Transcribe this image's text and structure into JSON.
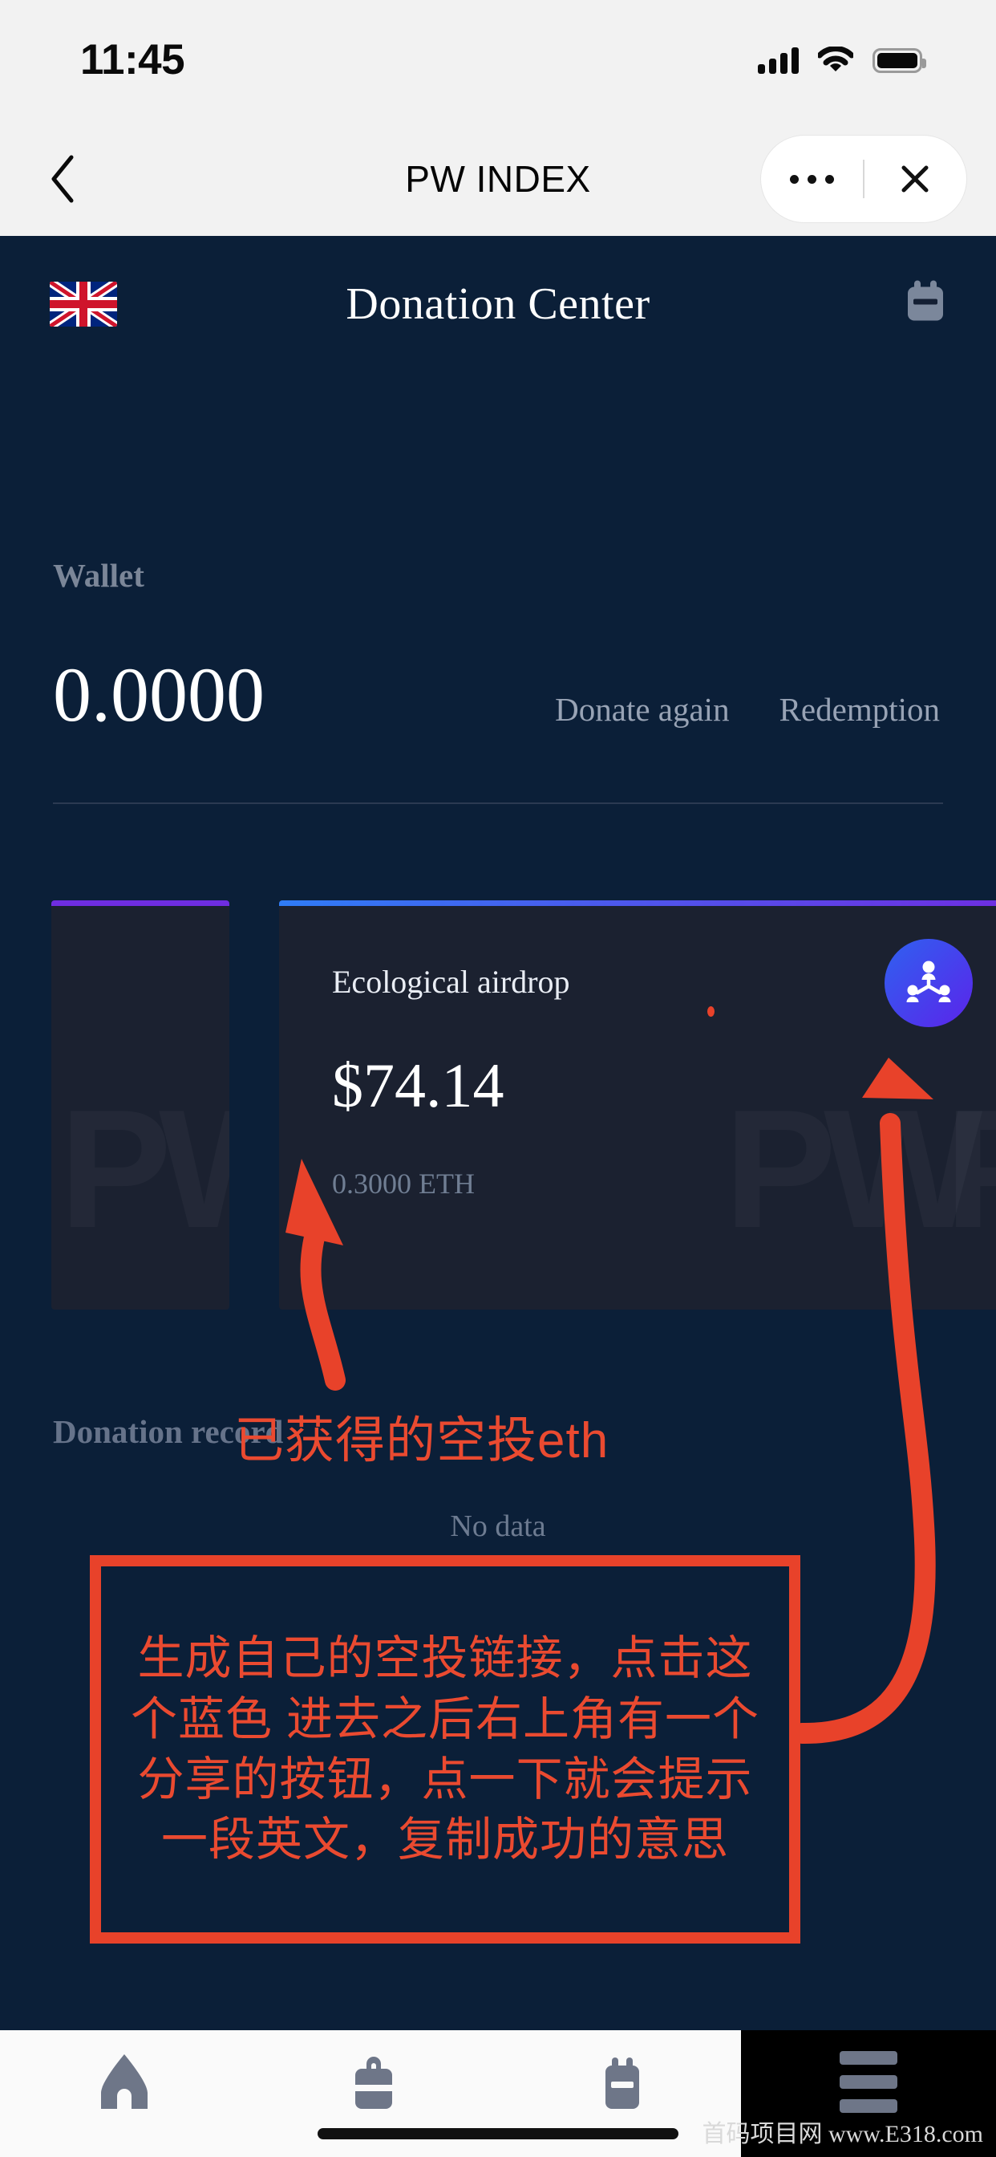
{
  "status_bar": {
    "time": "11:45",
    "signal_icon": "signal-bars-icon",
    "wifi_icon": "wifi-icon",
    "battery_icon": "battery-icon"
  },
  "nav_bar": {
    "back_icon": "chevron-left-icon",
    "title": "PW INDEX",
    "more_icon": "ellipsis-icon",
    "close_icon": "close-icon"
  },
  "app_header": {
    "language_flag": "uk-flag-icon",
    "title": "Donation Center",
    "calendar_icon": "calendar-icon"
  },
  "wallet": {
    "label": "Wallet",
    "amount": "0.0000",
    "donate_again": "Donate again",
    "redemption": "Redemption"
  },
  "cards": {
    "watermark_text": "PW",
    "left": {
      "accent_color": "#6f2de0"
    },
    "right": {
      "label": "Ecological airdrop",
      "amount": "$74.14",
      "sub_amount": "0.3000 ETH",
      "network_icon": "team-network-icon",
      "accent_color_start": "#2f7cf6",
      "accent_color_end": "#6f2de0"
    }
  },
  "donation_record": {
    "label": "Donation record",
    "empty_text": "No data"
  },
  "tab_bar": {
    "items": [
      {
        "icon": "home-icon",
        "name": "tab-home"
      },
      {
        "icon": "briefcase-icon",
        "name": "tab-briefcase"
      },
      {
        "icon": "calendar-icon",
        "name": "tab-calendar"
      },
      {
        "icon": "hamburger-menu-icon",
        "name": "tab-menu"
      }
    ]
  },
  "watermark": {
    "text": "首码项目网 www.E318.com"
  },
  "annotations": {
    "accent_color": "#e8422a",
    "callout_1": "已获得的空投eth",
    "callout_2": "生成自己的空投链接，点击这个蓝色 进去之后右上角有一个分享的按钮，点一下就会提示一段英文，复制成功的意思"
  }
}
